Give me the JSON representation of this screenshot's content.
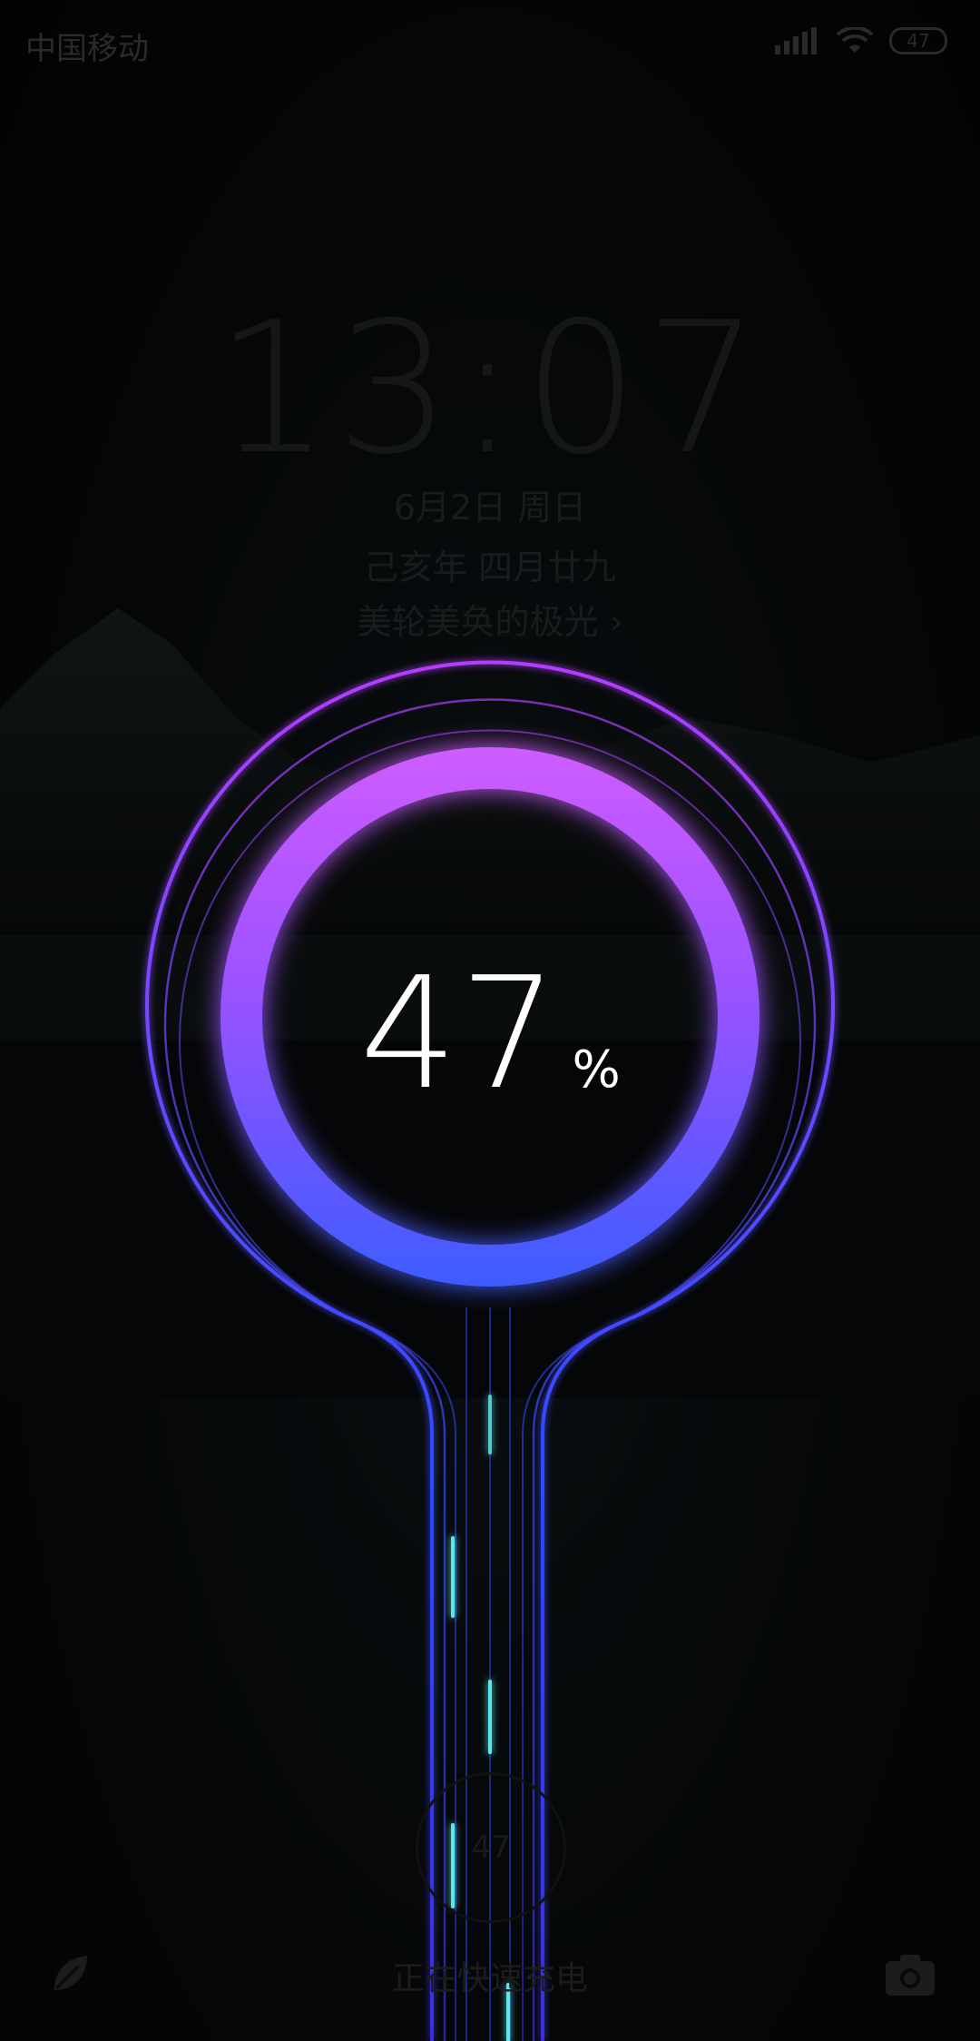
{
  "status_bar": {
    "carrier": "中国移动",
    "battery_level": "47",
    "icons": [
      "signal-icon",
      "wifi-icon",
      "battery-icon"
    ]
  },
  "lockscreen": {
    "time": "13:07",
    "date": "6月2日  周日",
    "lunar": "己亥年  四月廿九",
    "magazine_caption": "美轮美奂的极光 ›"
  },
  "charging": {
    "percent": "47",
    "percent_symbol": "%",
    "status_text": "正在快速充电",
    "small_ring_value": "47",
    "colors": {
      "ring_top": "#c040ff",
      "ring_bottom": "#2f4bff",
      "flow": "#5fe6e6"
    }
  },
  "bottom_bar": {
    "left_icon": "leaf-icon",
    "right_icon": "camera-icon"
  }
}
